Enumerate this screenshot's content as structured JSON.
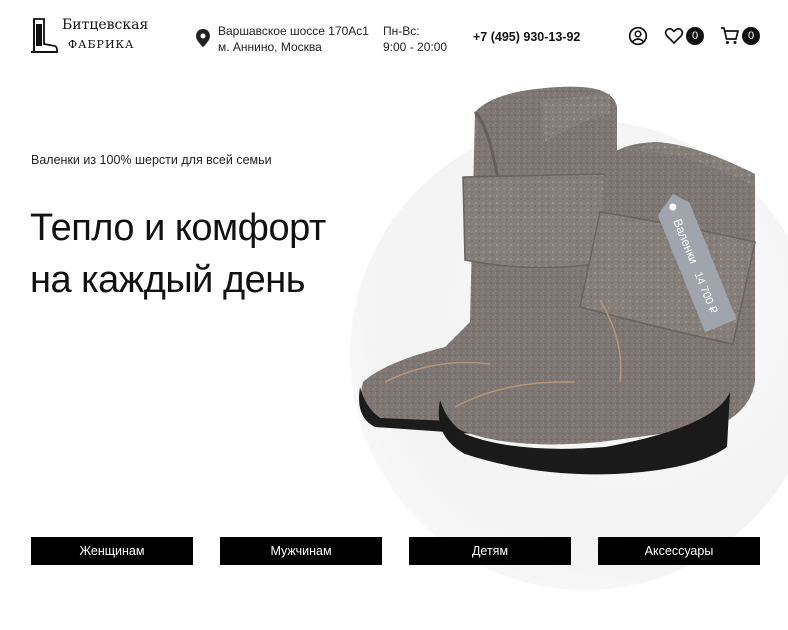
{
  "header": {
    "logo": {
      "line1": "Битцевская",
      "line2": "ФАБРИКА",
      "icon": "felt-boot-icon"
    },
    "address": {
      "line1": "Варшавское шоссе 170Ас1",
      "line2": "м. Аннино, Москва",
      "icon": "map-pin-icon"
    },
    "hours": {
      "line1": "Пн-Вс:",
      "line2": "9:00 - 20:00"
    },
    "phone": "+7 (495) 930-13-92",
    "icons": {
      "account": "user-icon",
      "favorites": "heart-icon",
      "cart": "cart-icon"
    },
    "favorites_count": "0",
    "cart_count": "0"
  },
  "hero": {
    "tagline": "Валенки из 100% шерсти для всей семьи",
    "headline_line1": "Тепло и комфорт",
    "headline_line2": "на каждый день",
    "price_tag": {
      "name": "Валенки",
      "price": "14 700 ₽"
    }
  },
  "categories": [
    {
      "label": "Женщинам"
    },
    {
      "label": "Мужчинам"
    },
    {
      "label": "Детям"
    },
    {
      "label": "Аксессуары"
    }
  ],
  "colors": {
    "button_bg": "#000000",
    "button_text": "#ffffff",
    "felt": "#7b7470",
    "sole": "#1b1b1b",
    "tag": "#9ea3ab"
  }
}
